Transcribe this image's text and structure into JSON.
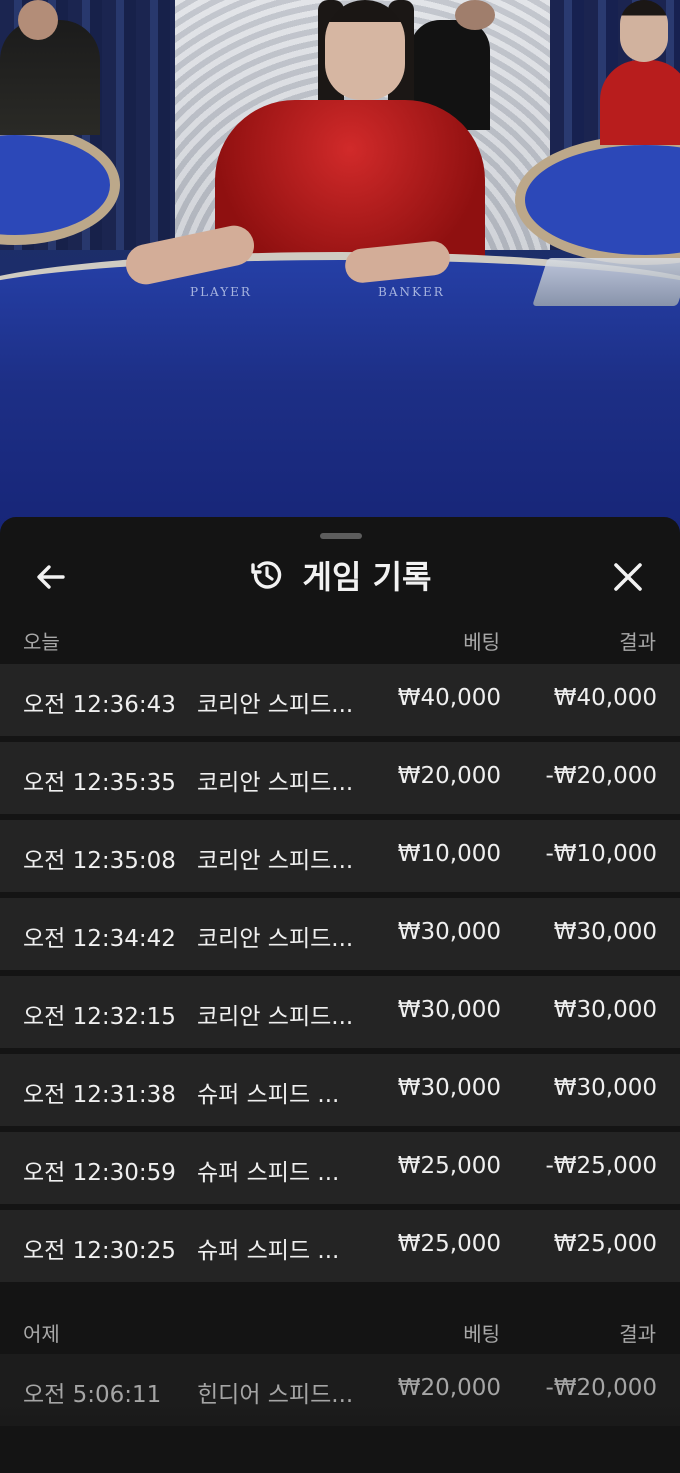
{
  "video": {
    "table_labels": [
      "PLAYER",
      "BANKER"
    ]
  },
  "header": {
    "title": "게임 기록",
    "icons": {
      "back": "arrow-left-icon",
      "history": "history-icon",
      "close": "close-icon"
    }
  },
  "sections": [
    {
      "label": "오늘",
      "bet_header": "베팅",
      "result_header": "결과",
      "rows": [
        {
          "time": "오전 12:36:43",
          "game": "코리안 스피드...",
          "bet": "₩40,000",
          "result": "₩40,000"
        },
        {
          "time": "오전 12:35:35",
          "game": "코리안 스피드...",
          "bet": "₩20,000",
          "result": "-₩20,000"
        },
        {
          "time": "오전 12:35:08",
          "game": "코리안 스피드...",
          "bet": "₩10,000",
          "result": "-₩10,000"
        },
        {
          "time": "오전 12:34:42",
          "game": "코리안 스피드...",
          "bet": "₩30,000",
          "result": "₩30,000"
        },
        {
          "time": "오전 12:32:15",
          "game": "코리안 스피드...",
          "bet": "₩30,000",
          "result": "₩30,000"
        },
        {
          "time": "오전 12:31:38",
          "game": "슈퍼 스피드 ...",
          "bet": "₩30,000",
          "result": "₩30,000"
        },
        {
          "time": "오전 12:30:59",
          "game": "슈퍼 스피드 ...",
          "bet": "₩25,000",
          "result": "-₩25,000"
        },
        {
          "time": "오전 12:30:25",
          "game": "슈퍼 스피드 ...",
          "bet": "₩25,000",
          "result": "₩25,000"
        }
      ]
    },
    {
      "label": "어제",
      "bet_header": "베팅",
      "result_header": "결과",
      "rows": [
        {
          "time": "오전 5:06:11",
          "game": "힌디어 스피드...",
          "bet": "₩20,000",
          "result": "-₩20,000"
        }
      ]
    }
  ]
}
